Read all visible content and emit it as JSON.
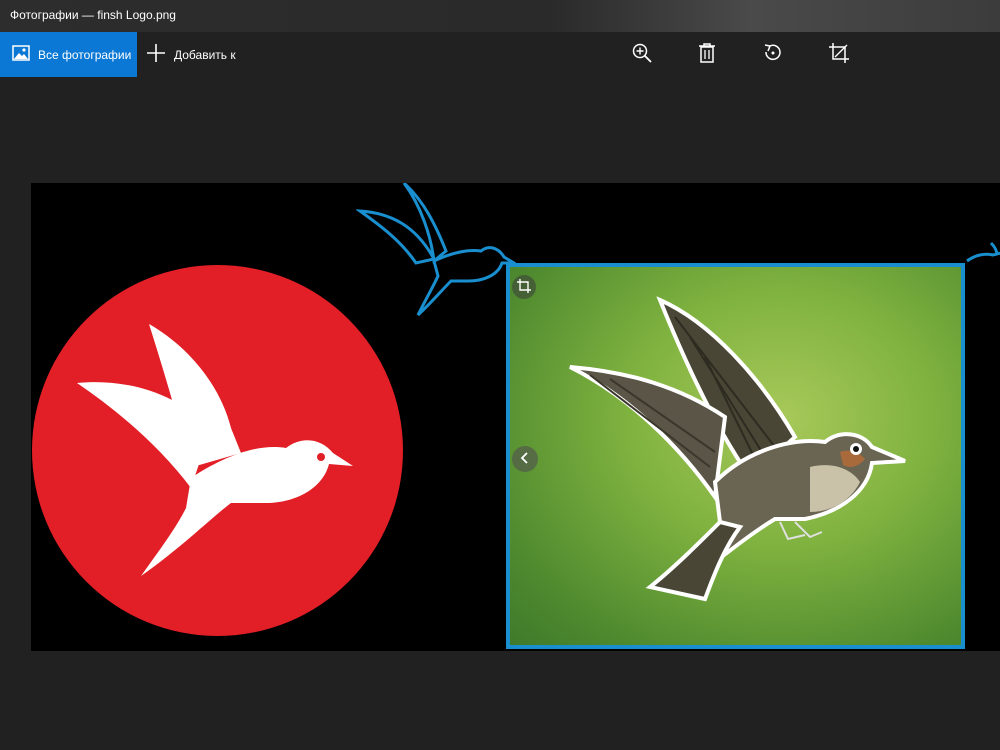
{
  "window": {
    "title": "Фотографии — finsh Logo.png"
  },
  "toolbar": {
    "all_photos_label": "Все фотографии",
    "add_to_label": "Добавить к",
    "tools": [
      {
        "name": "zoom-in-button",
        "icon": "zoom-in-icon"
      },
      {
        "name": "delete-button",
        "icon": "trash-icon"
      },
      {
        "name": "rotate-button",
        "icon": "rotate-icon"
      },
      {
        "name": "crop-button",
        "icon": "crop-icon"
      }
    ]
  },
  "colors": {
    "accent": "#0a78d4",
    "background": "#212121",
    "logo_red": "#e21f26",
    "frame_blue": "#1a8fd0"
  },
  "image": {
    "crop_badge_icon": "crop-icon",
    "nav_prev_icon": "chevron-left-icon"
  }
}
